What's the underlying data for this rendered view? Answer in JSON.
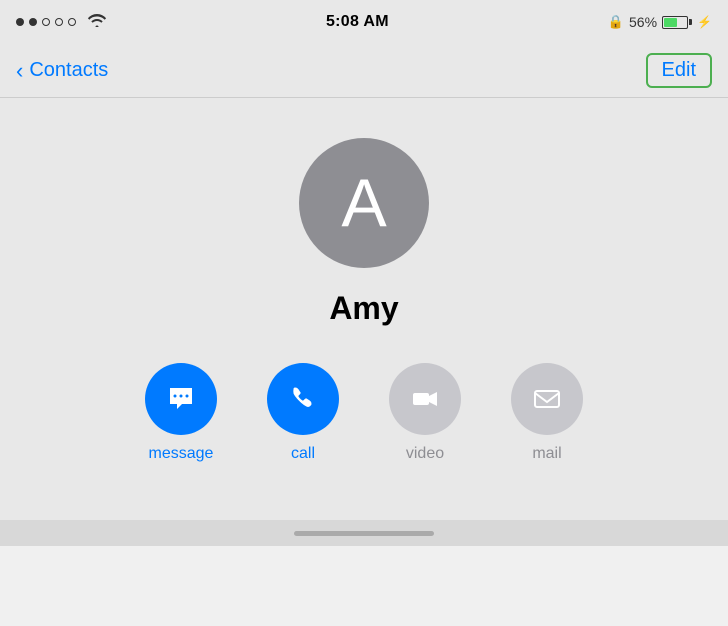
{
  "statusBar": {
    "time": "5:08 AM",
    "battery": "56%",
    "signal": "●●○○○"
  },
  "navBar": {
    "backLabel": "Contacts",
    "editLabel": "Edit"
  },
  "contact": {
    "name": "Amy",
    "initial": "A"
  },
  "actions": [
    {
      "id": "message",
      "label": "message",
      "icon": "💬",
      "style": "blue"
    },
    {
      "id": "call",
      "label": "call",
      "icon": "📞",
      "style": "blue"
    },
    {
      "id": "video",
      "label": "video",
      "icon": "📹",
      "style": "gray"
    },
    {
      "id": "mail",
      "label": "mail",
      "icon": "✉",
      "style": "gray"
    }
  ]
}
